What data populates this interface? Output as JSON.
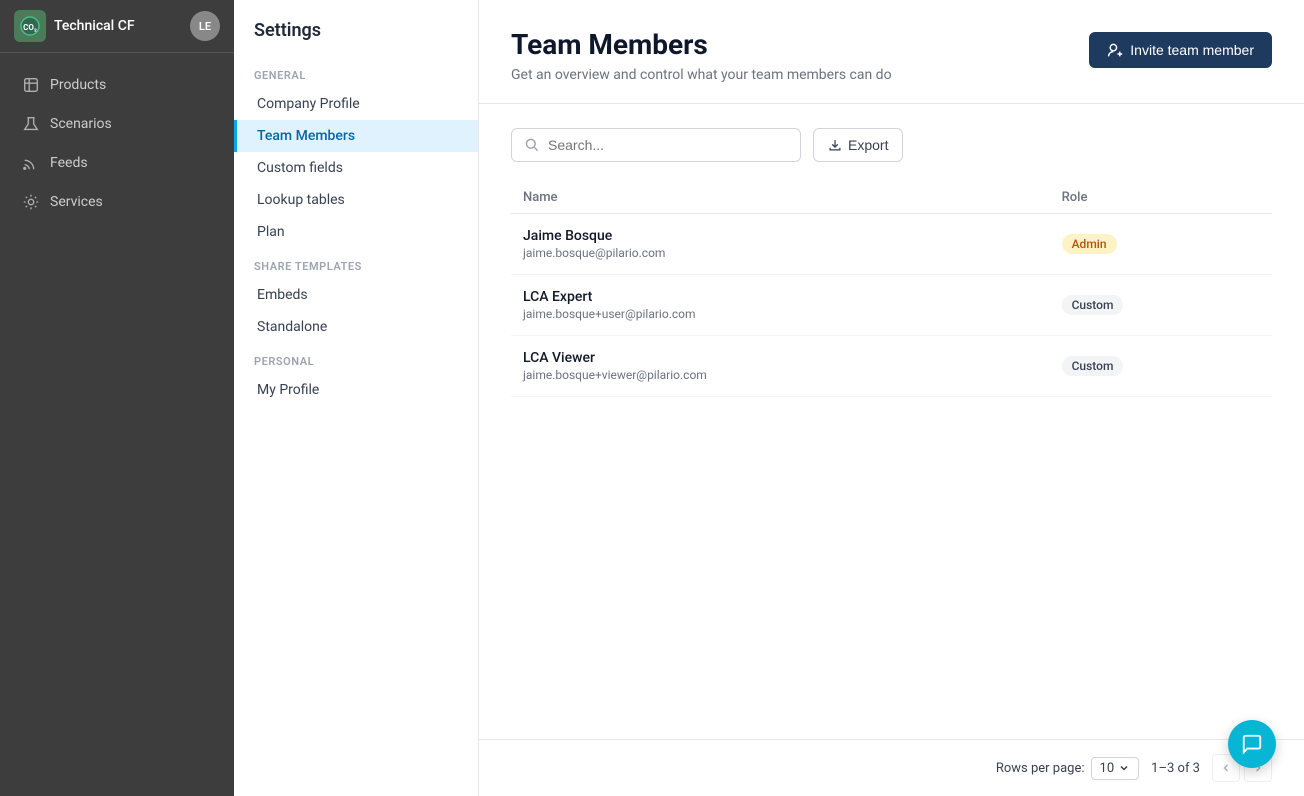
{
  "sidebar": {
    "brand_logo": "CO₂",
    "brand_name": "Technical CF",
    "user_initials": "LE",
    "nav_items": [
      {
        "id": "products",
        "label": "Products",
        "icon": "box-icon"
      },
      {
        "id": "scenarios",
        "label": "Scenarios",
        "icon": "beaker-icon"
      },
      {
        "id": "feeds",
        "label": "Feeds",
        "icon": "feed-icon"
      },
      {
        "id": "services",
        "label": "Services",
        "icon": "services-icon"
      }
    ]
  },
  "settings": {
    "title": "Settings",
    "sections": [
      {
        "id": "general",
        "label": "GENERAL",
        "items": [
          {
            "id": "company-profile",
            "label": "Company Profile",
            "active": false
          },
          {
            "id": "team-members",
            "label": "Team Members",
            "active": true
          },
          {
            "id": "custom-fields",
            "label": "Custom fields",
            "active": false
          },
          {
            "id": "lookup-tables",
            "label": "Lookup tables",
            "active": false
          },
          {
            "id": "plan",
            "label": "Plan",
            "active": false
          }
        ]
      },
      {
        "id": "share-templates",
        "label": "SHARE TEMPLATES",
        "items": [
          {
            "id": "embeds",
            "label": "Embeds",
            "active": false
          },
          {
            "id": "standalone",
            "label": "Standalone",
            "active": false
          }
        ]
      },
      {
        "id": "personal",
        "label": "PERSONAL",
        "items": [
          {
            "id": "my-profile",
            "label": "My Profile",
            "active": false
          }
        ]
      }
    ]
  },
  "main": {
    "title": "Team Members",
    "subtitle": "Get an overview and control what your team members can do",
    "invite_button_label": "Invite team member",
    "search_placeholder": "Search...",
    "export_label": "Export",
    "table": {
      "columns": [
        {
          "id": "name",
          "label": "Name"
        },
        {
          "id": "role",
          "label": "Role"
        }
      ],
      "rows": [
        {
          "id": 1,
          "name": "Jaime Bosque",
          "email": "jaime.bosque@pilario.com",
          "role": "Admin",
          "role_type": "admin"
        },
        {
          "id": 2,
          "name": "LCA Expert",
          "email": "jaime.bosque+user@pilario.com",
          "role": "Custom",
          "role_type": "custom"
        },
        {
          "id": 3,
          "name": "LCA Viewer",
          "email": "jaime.bosque+viewer@pilario.com",
          "role": "Custom",
          "role_type": "custom"
        }
      ]
    },
    "pagination": {
      "rows_per_page_label": "Rows per page:",
      "rows_per_page_value": "10",
      "page_info": "1–3 of 3"
    }
  }
}
